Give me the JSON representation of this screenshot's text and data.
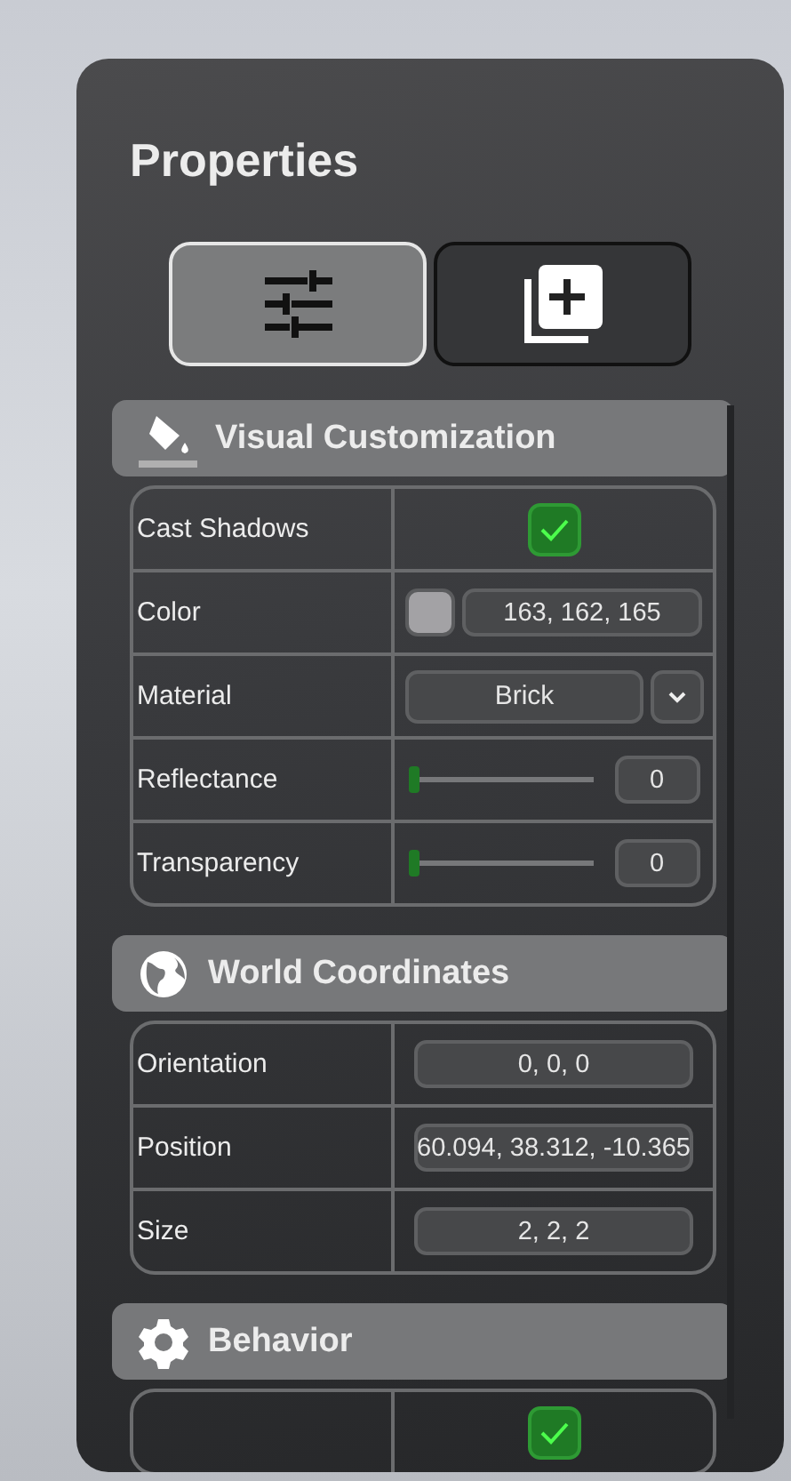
{
  "panel": {
    "title": "Properties"
  },
  "tabs": [
    {
      "selected": true
    },
    {
      "selected": false
    }
  ],
  "sections": [
    {
      "title": "Visual Customization",
      "rows": [
        {
          "kind": "checkbox",
          "label": "Cast Shadows",
          "checked": true
        },
        {
          "kind": "color",
          "label": "Color",
          "color": "#a3a2a5",
          "value": "163, 162, 165"
        },
        {
          "kind": "dropdown",
          "label": "Material",
          "value": "Brick"
        },
        {
          "kind": "slider",
          "label": "Reflectance",
          "level": 0,
          "value": "0"
        },
        {
          "kind": "slider",
          "label": "Transparency",
          "level": 0,
          "value": "0"
        }
      ]
    },
    {
      "title": "World Coordinates",
      "rows": [
        {
          "kind": "text",
          "label": "Orientation",
          "value": "0, 0, 0"
        },
        {
          "kind": "text",
          "label": "Position",
          "value": "60.094, 38.312, -10.365"
        },
        {
          "kind": "text",
          "label": "Size",
          "value": "2, 2, 2"
        }
      ]
    },
    {
      "title": "Behavior",
      "rows": [
        {
          "kind": "checkbox",
          "checked": true
        }
      ]
    }
  ]
}
